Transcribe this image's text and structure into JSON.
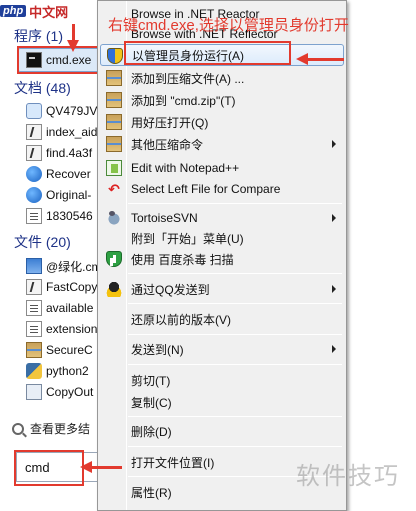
{
  "logo": {
    "mark": "php",
    "text": "中文网"
  },
  "annotation": "右键cmd.exe,选择以管理员身份打开",
  "watermark": "软件技巧",
  "groups": {
    "programs": "程序 (1)",
    "documents": "文档 (48)",
    "files": "文件 (20)"
  },
  "programs": [
    {
      "name": "cmd.exe",
      "icon": "cmd-icon"
    }
  ],
  "documents": [
    {
      "name": "QV479JV",
      "icon": "net-icon"
    },
    {
      "name": "index_aid",
      "icon": "script-icon"
    },
    {
      "name": "find.4a3f",
      "icon": "script-icon"
    },
    {
      "name": "Recover",
      "icon": "earth-icon"
    },
    {
      "name": "Original-",
      "icon": "earth-icon"
    },
    {
      "name": "1830546",
      "icon": "document-icon"
    }
  ],
  "files": [
    {
      "name": "@绿化.cm",
      "icon": "cmd-file-icon"
    },
    {
      "name": "FastCopy",
      "icon": "script-icon"
    },
    {
      "name": "available",
      "icon": "document-icon"
    },
    {
      "name": "extension",
      "icon": "document-icon"
    },
    {
      "name": "SecureC",
      "icon": "archive-icon"
    },
    {
      "name": "python2",
      "icon": "python-icon"
    },
    {
      "name": "CopyOut",
      "icon": "copy-icon"
    }
  ],
  "search_more": "查看更多结",
  "search_value": "cmd",
  "menu": {
    "reactor": "Browse in .NET Reactor",
    "reflector": "Browse with .NET Reflector",
    "run_as_admin": "以管理员身份运行(A)",
    "add_archive": "添加到压缩文件(A) ...",
    "add_zip": "添加到 \"cmd.zip\"(T)",
    "open_haozip": "用好压打开(Q)",
    "other_zip": "其他压缩命令",
    "notepad": "Edit with Notepad++",
    "compare": "Select Left File for Compare",
    "svn": "TortoiseSVN",
    "pin_start": "附到「开始」菜单(U)",
    "baidu_scan": "使用 百度杀毒 扫描",
    "qq_send": "通过QQ发送到",
    "restore": "还原以前的版本(V)",
    "send_to": "发送到(N)",
    "cut": "剪切(T)",
    "copy": "复制(C)",
    "delete": "删除(D)",
    "open_location": "打开文件位置(I)",
    "properties": "属性(R)"
  },
  "colors": {
    "annotation": "#e23a2e",
    "group_header": "#1e3287",
    "menu_bg": "#f0f0f0"
  }
}
